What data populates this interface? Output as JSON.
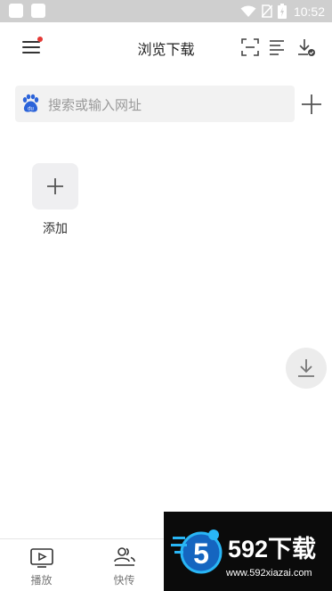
{
  "status_bar": {
    "time": "10:52",
    "icons": [
      "wifi-icon",
      "no-sim-icon",
      "battery-icon"
    ]
  },
  "header": {
    "title": "浏览下载",
    "has_notification": true,
    "icons": [
      "menu-icon",
      "scan-icon",
      "list-icon",
      "download-manager-icon"
    ]
  },
  "search": {
    "placeholder": "搜索或输入网址",
    "engine_icon": "baidu-icon"
  },
  "quick_links": [
    {
      "label": "添加",
      "icon": "plus-icon"
    }
  ],
  "bottom_nav": [
    {
      "label": "播放",
      "icon": "play-video-icon"
    },
    {
      "label": "快传",
      "icon": "users-transfer-icon"
    }
  ],
  "watermark": {
    "brand": "592下载",
    "url": "www.592xiazai.com"
  },
  "colors": {
    "status_bar": "#cfcfcf",
    "notification_dot": "#e53935",
    "search_bg": "#f2f2f2",
    "baidu_blue": "#2b63d9",
    "watermark_bg": "#0b0b0b"
  }
}
